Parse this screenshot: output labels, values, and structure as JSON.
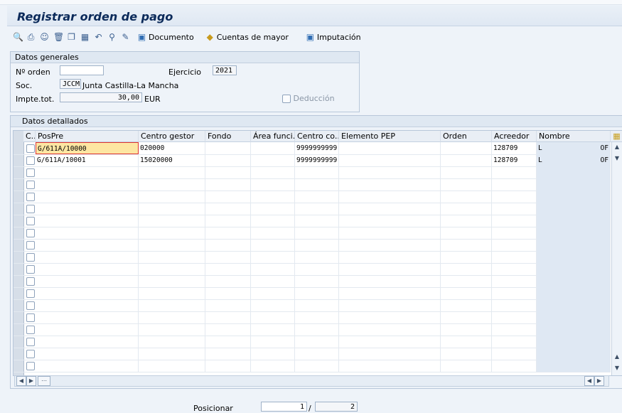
{
  "title": "Registrar orden de pago",
  "toolbar": {
    "icons": [
      "display-icon",
      "print-icon",
      "user-icon",
      "delete-icon",
      "copy-icon",
      "calculator-icon",
      "undo-icon",
      "hierarchy-icon",
      "edit-icon"
    ],
    "buttons": [
      {
        "label": "Documento",
        "icon": "document-icon"
      },
      {
        "label": "Cuentas de mayor",
        "icon": "ledger-icon"
      },
      {
        "label": "Imputación",
        "icon": "assignment-icon"
      }
    ]
  },
  "general": {
    "header": "Datos generales",
    "orden_label": "Nº orden",
    "orden_value": "",
    "ejercicio_label": "Ejercicio",
    "ejercicio_value": "2021",
    "soc_label": "Soc.",
    "soc_code": "JCCM",
    "soc_name": "Junta Castilla-La Mancha",
    "importe_label": "Impte.tot.",
    "importe_value": "30,00",
    "currency": "EUR",
    "deduccion_label": "Deducción"
  },
  "detail": {
    "header": "Datos detallados",
    "columns": [
      "C..",
      "PosPre",
      "Centro gestor",
      "Fondo",
      "Área funci...",
      "Centro co...",
      "Elemento PEP",
      "Orden",
      "Acreedor",
      "Nombre"
    ],
    "rows": [
      {
        "pospre": "G/611A/10000",
        "centro_gestor": "020000",
        "fondo": "",
        "area": "",
        "centro_co": "9999999999",
        "pep": "",
        "orden": "",
        "acreedor": "128709",
        "nombre_a": "L",
        "nombre_b": "OF"
      },
      {
        "pospre": "G/611A/10001",
        "centro_gestor": "15020000",
        "fondo": "",
        "area": "",
        "centro_co": "9999999999",
        "pep": "",
        "orden": "",
        "acreedor": "128709",
        "nombre_a": "L",
        "nombre_b": "OF"
      }
    ]
  },
  "footer": {
    "posicionar_label": "Posicionar",
    "position_value": "1",
    "separator": "/",
    "total": "2"
  }
}
